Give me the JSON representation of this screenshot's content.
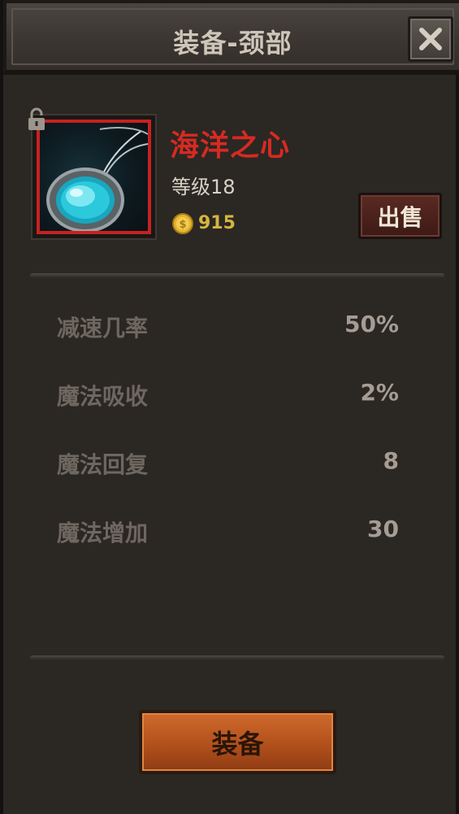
{
  "dialog": {
    "title": "装备-颈部"
  },
  "item": {
    "name": "海洋之心",
    "level": "等级18",
    "price": "915",
    "locked": true,
    "icon": "blue-amulet-pendant",
    "border_color": "#c62121",
    "name_color": "#d62a22"
  },
  "buttons": {
    "sell_label": "出售",
    "equip_label": "装备",
    "close_icon": "close-icon"
  },
  "stats": [
    {
      "label": "减速几率",
      "value": "50%"
    },
    {
      "label": "魔法吸收",
      "value": "2%"
    },
    {
      "label": "魔法回复",
      "value": "8"
    },
    {
      "label": "魔法增加",
      "value": "30"
    }
  ]
}
